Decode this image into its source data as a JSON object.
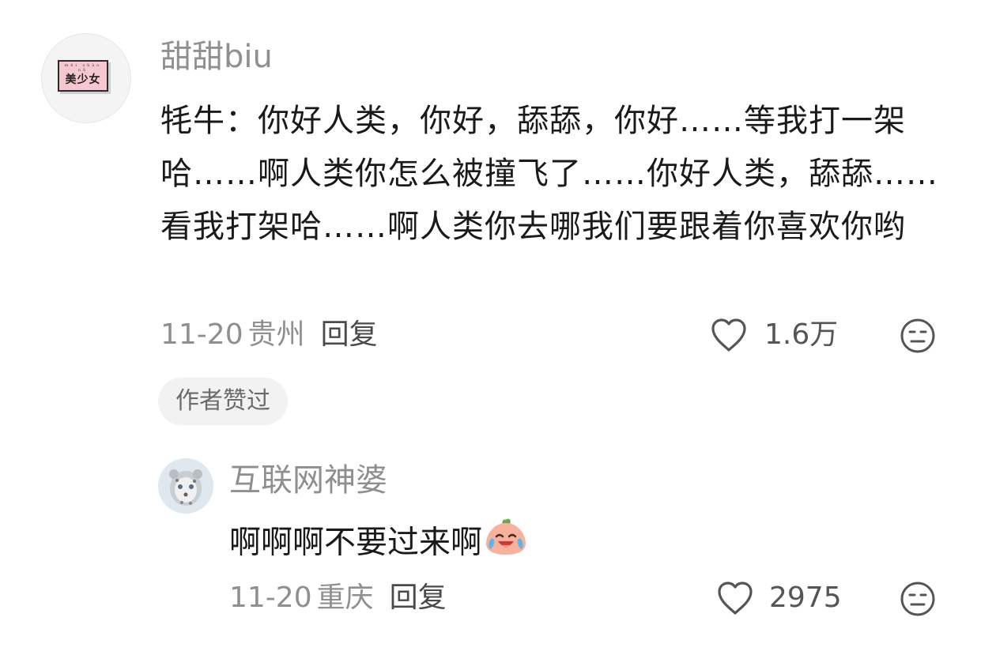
{
  "comment": {
    "username": "甜甜biu",
    "avatar": {
      "text": "美少女",
      "pinyin": "měi shào nǚ"
    },
    "text": "牦牛：你好人类，你好，舔舔，你好……等我打一架哈……啊人类你怎么被撞飞了……你好人类，舔舔……看我打架哈……啊人类你去哪我们要跟着你喜欢你哟",
    "date": "11-20",
    "location": "贵州",
    "reply_label": "回复",
    "likes": "1.6万",
    "like_icon": "heart-outline-icon",
    "dislike_icon": "meh-face-icon",
    "badge": "作者赞过"
  },
  "reply": {
    "username": "互联网神婆",
    "avatar_icon": "snow-leopard-avatar",
    "text": "啊啊啊不要过来啊",
    "emoji": "crying-laughing-peach-emoji",
    "date": "11-20",
    "location": "重庆",
    "reply_label": "回复",
    "likes": "2975"
  }
}
